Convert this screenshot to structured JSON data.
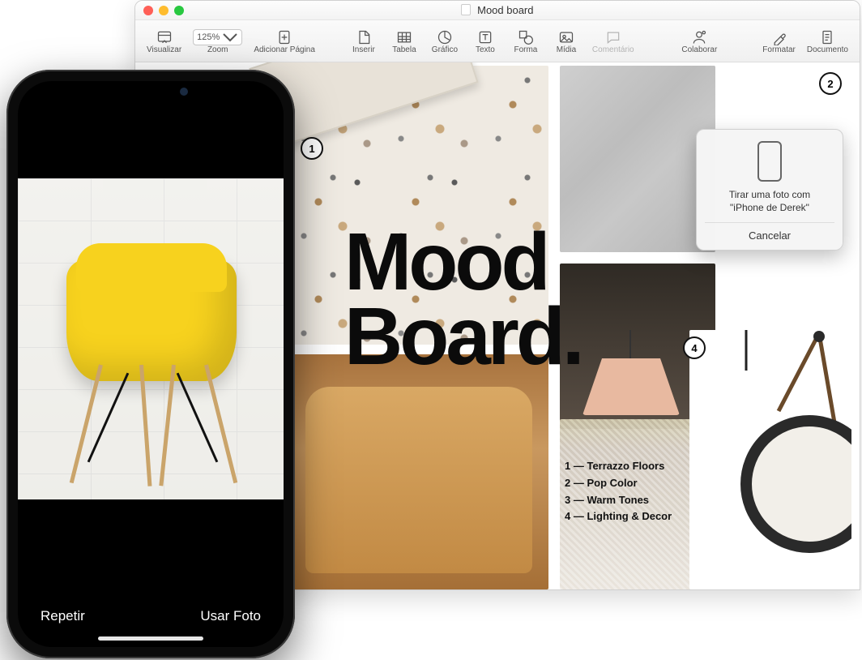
{
  "window": {
    "title": "Mood board",
    "toolbar": {
      "view": "Visualizar",
      "zoom_value": "125%",
      "zoom_label": "Zoom",
      "add_page": "Adicionar Página",
      "insert": "Inserir",
      "table": "Tabela",
      "chart": "Gráfico",
      "text": "Texto",
      "shape": "Forma",
      "media": "Mídia",
      "comment": "Comentário",
      "collaborate": "Colaborar",
      "format": "Formatar",
      "document": "Documento"
    }
  },
  "document": {
    "title_line1": "Mood",
    "title_line2": "Board.",
    "legend": [
      {
        "num": "1",
        "label": "Terrazzo Floors"
      },
      {
        "num": "2",
        "label": "Pop Color"
      },
      {
        "num": "3",
        "label": "Warm Tones"
      },
      {
        "num": "4",
        "label": "Lighting & Decor"
      }
    ],
    "badges": {
      "b1": "1",
      "b2": "2",
      "b4": "4"
    }
  },
  "popover": {
    "line1": "Tirar uma foto com",
    "line2": "\"iPhone de Derek\"",
    "cancel": "Cancelar"
  },
  "iphone": {
    "retake": "Repetir",
    "use_photo": "Usar Foto"
  }
}
